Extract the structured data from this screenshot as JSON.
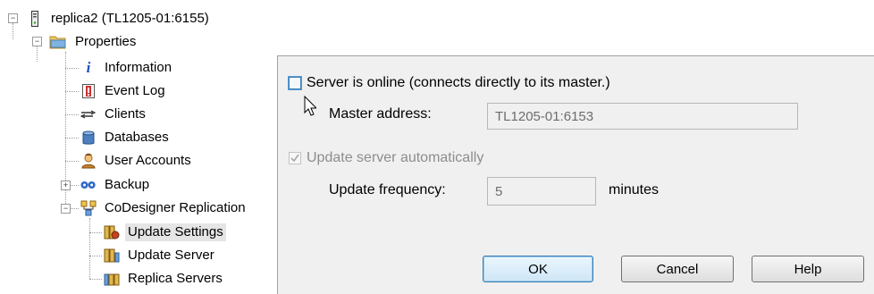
{
  "tree": {
    "root_label": "replica2 (TL1205-01:6155)",
    "properties_label": "Properties",
    "items": [
      {
        "label": "Information",
        "icon": "info-icon"
      },
      {
        "label": "Event Log",
        "icon": "event-log-icon"
      },
      {
        "label": "Clients",
        "icon": "clients-icon"
      },
      {
        "label": "Databases",
        "icon": "database-icon"
      },
      {
        "label": "User Accounts",
        "icon": "user-accounts-icon"
      },
      {
        "label": "Backup",
        "icon": "backup-icon"
      },
      {
        "label": "CoDesigner Replication",
        "icon": "replication-icon"
      }
    ],
    "replication_children": [
      {
        "label": "Update Settings",
        "icon": "update-settings-icon",
        "selected": true
      },
      {
        "label": "Update Server",
        "icon": "update-server-icon"
      },
      {
        "label": "Replica Servers",
        "icon": "replica-servers-icon"
      }
    ]
  },
  "settings": {
    "online_label": "Server is online (connects directly to its master.)",
    "online_checked": false,
    "master_address_label": "Master address:",
    "master_address_value": "TL1205-01:6153",
    "auto_update_label": "Update server automatically",
    "auto_update_checked": true,
    "frequency_label": "Update frequency:",
    "frequency_value": "5",
    "frequency_unit": "minutes"
  },
  "buttons": {
    "ok": "OK",
    "cancel": "Cancel",
    "help": "Help"
  },
  "colors": {
    "folder": "#f2c14e",
    "accent": "#3c7fb1",
    "disabled_text": "#8d8d8d"
  }
}
